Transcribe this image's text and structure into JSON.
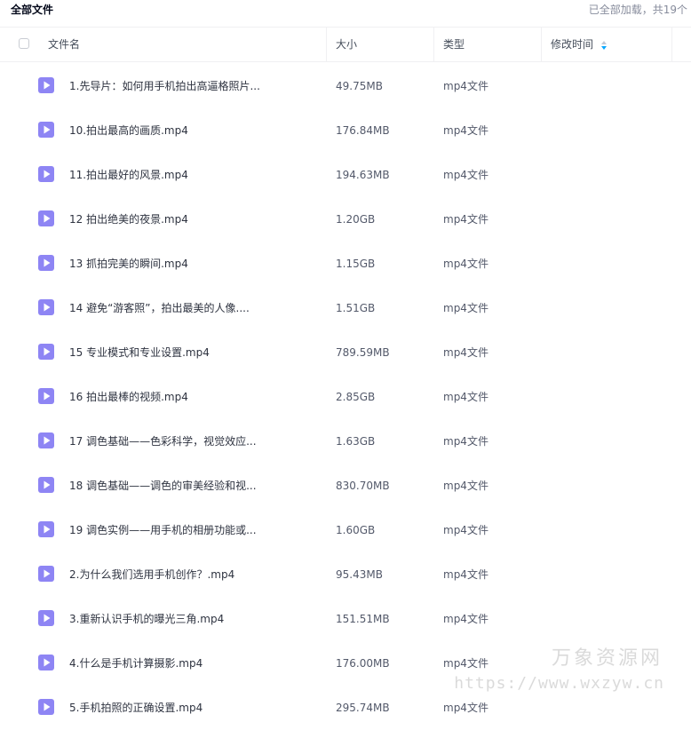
{
  "breadcrumb": "全部文件",
  "load_status": "已全部加载，共19个",
  "columns": {
    "name": "文件名",
    "size": "大小",
    "type": "类型",
    "modified": "修改时间"
  },
  "colors": {
    "file_icon": "#8e85f4",
    "sort_icon": "#06a7ff"
  },
  "icons": {
    "file": "video-file-icon",
    "sort": "sort-icon"
  },
  "files": [
    {
      "name": "1.先导片：如何用手机拍出高逼格照片...",
      "size": "49.75MB",
      "type": "mp4文件"
    },
    {
      "name": "10.拍出最高的画质.mp4",
      "size": "176.84MB",
      "type": "mp4文件"
    },
    {
      "name": "11.拍出最好的风景.mp4",
      "size": "194.63MB",
      "type": "mp4文件"
    },
    {
      "name": "12 拍出绝美的夜景.mp4",
      "size": "1.20GB",
      "type": "mp4文件"
    },
    {
      "name": "13 抓拍完美的瞬间.mp4",
      "size": "1.15GB",
      "type": "mp4文件"
    },
    {
      "name": "14 避免“游客照”，拍出最美的人像....",
      "size": "1.51GB",
      "type": "mp4文件"
    },
    {
      "name": "15 专业模式和专业设置.mp4",
      "size": "789.59MB",
      "type": "mp4文件"
    },
    {
      "name": "16 拍出最棒的视频.mp4",
      "size": "2.85GB",
      "type": "mp4文件"
    },
    {
      "name": "17 调色基础——色彩科学，视觉效应...",
      "size": "1.63GB",
      "type": "mp4文件"
    },
    {
      "name": "18 调色基础——调色的审美经验和视...",
      "size": "830.70MB",
      "type": "mp4文件"
    },
    {
      "name": "19 调色实例——用手机的相册功能或...",
      "size": "1.60GB",
      "type": "mp4文件"
    },
    {
      "name": "2.为什么我们选用手机创作？.mp4",
      "size": "95.43MB",
      "type": "mp4文件"
    },
    {
      "name": "3.重新认识手机的曝光三角.mp4",
      "size": "151.51MB",
      "type": "mp4文件"
    },
    {
      "name": "4.什么是手机计算摄影.mp4",
      "size": "176.00MB",
      "type": "mp4文件"
    },
    {
      "name": "5.手机拍照的正确设置.mp4",
      "size": "295.74MB",
      "type": "mp4文件"
    }
  ],
  "watermark": {
    "name": "万象资源网",
    "url": "https://www.wxzyw.cn"
  }
}
